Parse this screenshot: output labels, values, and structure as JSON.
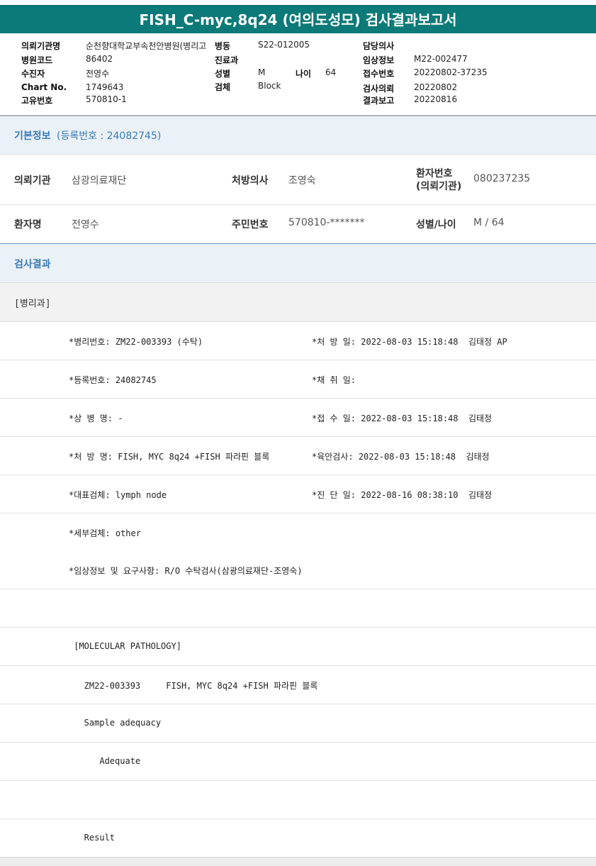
{
  "report": {
    "title": "FISH_C-myc,8q24 (여의도성모) 검사결과보고서"
  },
  "header": {
    "institution_label": "의뢰기관명",
    "institution_value": "순천향대학교부속천안병원(병리고",
    "ward_label": "병동",
    "ward_value": "S22-012005",
    "doctor_label": "담당의사",
    "doctor_value": "",
    "hospital_code_label": "병원코드",
    "hospital_code_value": "86402",
    "dept_label": "진료과",
    "dept_value": "",
    "clinical_label": "임상정보",
    "clinical_value": "M22-002477",
    "patient_label": "수진자",
    "patient_value": "전영수",
    "sex_label": "성별",
    "sex_value": "M",
    "age_label": "나이",
    "age_value": "64",
    "receipt_label": "접수번호",
    "receipt_value": "20220802-37235",
    "chart_label": "Chart No.",
    "chart_value": "1749643",
    "specimen_label": "검체",
    "specimen_value": "Block",
    "request_label": "검사의뢰",
    "request_value": "20220802",
    "unique_label": "고유번호",
    "unique_value": "570810-1",
    "report_label": "결과보고",
    "report_value": "20220816"
  },
  "basic_info": {
    "heading": "기본정보",
    "registration": "(등록번호 : 24082745)",
    "requester_label": "의뢰기관",
    "requester_value": "삼광의료재단",
    "prescriber_label": "처방의사",
    "prescriber_value": "조영숙",
    "patient_no_label_1": "환자번호",
    "patient_no_label_2": "(의뢰기관)",
    "patient_no_value": "080237235",
    "name_label": "환자명",
    "name_value": "전영수",
    "rrn_label": "주민번호",
    "rrn_value": "570810-*******",
    "sexage_label": "성별/나이",
    "sexage_value": "M / 64"
  },
  "results": {
    "heading": "검사결과",
    "dept": "[병리과]",
    "lines": [
      {
        "left": "*병리번호: ZM22-003393 (수탁)",
        "right": "*처 방 일: 2022-08-03 15:18:48  김태정 AP"
      },
      {
        "left": "*등록번호: 24082745",
        "right": "*채 취 일:"
      },
      {
        "left": "*상 병 명: -",
        "right": "*접 수 일: 2022-08-03 15:18:48  김태정"
      },
      {
        "left": "*처 방 명: FISH, MYC 8q24 +FISH 파라핀 블록",
        "right": "*육안검사: 2022-08-03 15:18:48  김태정"
      },
      {
        "left": "*대표검체: lymph node",
        "right": "*진 단 일: 2022-08-16 08:38:10  김태정"
      },
      {
        "left": "*세부검체: other",
        "right": ""
      },
      {
        "left": "*임상정보 및 요구사항: R/O 수탁검사(삼광의료재단-조영숙)",
        "right": ""
      },
      {
        "left": "",
        "right": ""
      },
      {
        "left": " [MOLECULAR PATHOLOGY]",
        "right": ""
      },
      {
        "left": "   ZM22-003393     FISH, MYC 8q24 +FISH 파라핀 블록",
        "right": ""
      },
      {
        "left": "   Sample adequacy",
        "right": ""
      },
      {
        "left": "      Adequate",
        "right": ""
      },
      {
        "left": "",
        "right": ""
      },
      {
        "left": "   Result",
        "right": ""
      }
    ]
  }
}
